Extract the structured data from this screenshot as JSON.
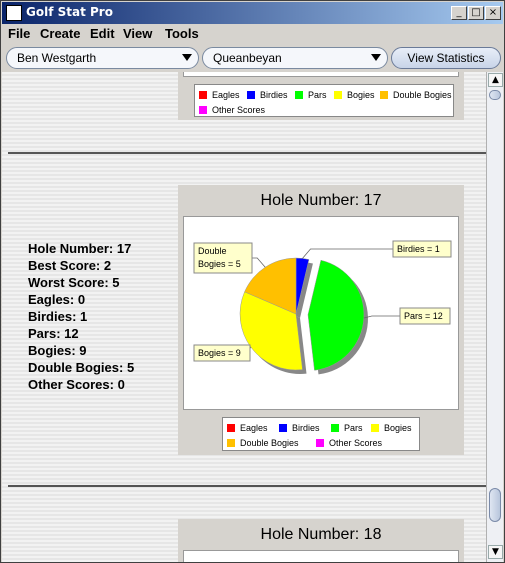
{
  "window": {
    "title": "Golf Stat Pro"
  },
  "menu": [
    "File",
    "Create",
    "Edit",
    "View",
    "Tools"
  ],
  "toolbar": {
    "player": "Ben Westgarth",
    "course": "Queanbeyan",
    "view_button": "View Statistics"
  },
  "legend": {
    "eagles": "Eagles",
    "birdies": "Birdies",
    "pars": "Pars",
    "bogies": "Bogies",
    "double_bogies": "Double Bogies",
    "other_scores": "Other Scores"
  },
  "hole17": {
    "title": "Hole Number: 17",
    "stats": {
      "hole": "Hole Number: 17",
      "best": "Best Score: 2",
      "worst": "Worst Score: 5",
      "eagles": "Eagles: 0",
      "birdies": "Birdies: 1",
      "pars": "Pars: 12",
      "bogies": "Bogies: 9",
      "double_bogies": "Double Bogies: 5",
      "other": "Other Scores: 0"
    },
    "labels": {
      "birdies": "Birdies = 1",
      "pars": "Pars = 12",
      "bogies": "Bogies = 9",
      "double_line1": "Double",
      "double_line2": "Bogies = 5"
    }
  },
  "hole18": {
    "title": "Hole Number: 18"
  },
  "colors": {
    "eagles": "#ff0000",
    "birdies": "#0000ff",
    "pars": "#00ff00",
    "bogies": "#ffff00",
    "double_bogies": "#ffc000",
    "other_scores": "#ff00ff"
  },
  "chart_data": {
    "type": "pie",
    "title": "Hole Number: 17",
    "categories": [
      "Eagles",
      "Birdies",
      "Pars",
      "Bogies",
      "Double Bogies",
      "Other Scores"
    ],
    "values": [
      0,
      1,
      12,
      9,
      5,
      0
    ],
    "colors": [
      "#ff0000",
      "#0000ff",
      "#00ff00",
      "#ffff00",
      "#ffc000",
      "#ff00ff"
    ],
    "exploded": "Pars",
    "legend": "bottom"
  }
}
